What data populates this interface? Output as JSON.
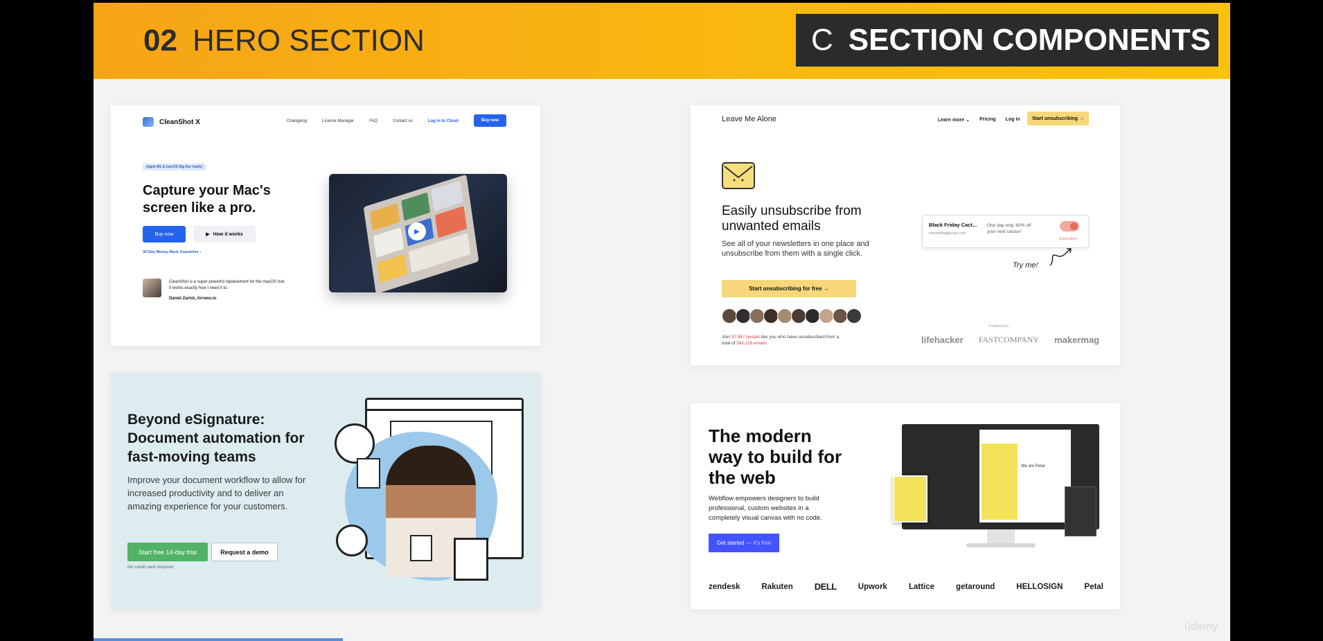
{
  "banner": {
    "number": "02",
    "title": "HERO SECTION",
    "right_letter": "C",
    "right_title": "SECTION COMPONENTS"
  },
  "cleanshot": {
    "logo": "CleanShot X",
    "nav": [
      "Changelog",
      "License Manager",
      "FAQ",
      "Contact us",
      "Log in to Cloud"
    ],
    "buy_top": "Buy now",
    "pill": "Apple M1 & macOS Big Sur ready!",
    "headline": "Capture your Mac's screen like a pro.",
    "buy": "Buy now",
    "how": "How it works",
    "guarantee": "30-Day Money-Back Guarantee ›",
    "quote": "CleanShot is a super powerful replacement for the macOS tool. It works exactly how I need it to.",
    "author": "Daniel Zarick, Arrows.to"
  },
  "leave_me_alone": {
    "logo": "Leave Me Alone",
    "nav": [
      "Learn more ⌄",
      "Pricing",
      "Log in"
    ],
    "cta_top": "Start unsubscribing →",
    "headline": "Easily unsubscribe from unwanted emails",
    "sub": "See all of your newsletters in one place and unsubscribe from them with a single click.",
    "cta": "Start unsubscribing for free →",
    "join_1": "Join ",
    "join_people": "37,967 people",
    "join_2": " like you who have unsubscribed from a total of ",
    "join_emails": "541,116 emails",
    "mail_title": "Black Friday Cact...",
    "mail_from": "rmarketing@cact.com",
    "mail_body": "One day only. 80% off your next cactus!",
    "mail_status": "Subscribed",
    "try": "Try me!",
    "featured": "Featured in",
    "press": [
      "lifehacker",
      "FASTCOMPANY",
      "makermag"
    ]
  },
  "esignature": {
    "headline": "Beyond eSignature: Document automation for fast-moving teams",
    "body": "Improve your document workflow to allow for increased productivity and to deliver an amazing experience for your customers.",
    "trial": "Start free 14-day trial",
    "demo": "Request a demo",
    "note": "No credit card required"
  },
  "webflow": {
    "headline": "The modern way to build for the web",
    "body": "Webflow empowers designers to build professional, custom websites in a completely visual canvas with no code.",
    "cta": "Get started",
    "cta_light": "— it's free",
    "canvas_text": "We are Petal",
    "logos": [
      "zendesk",
      "Rakuten",
      "DELL",
      "Upwork",
      "Lattice",
      "getaround",
      "HELLOSIGN",
      "Petal"
    ]
  },
  "watermark": "ūdemy",
  "colors": {
    "accent_orange": "#f7aa15",
    "dark": "#2b2b2b",
    "cleanshot_blue": "#2563eb",
    "webflow_blue": "#4353ff",
    "green": "#52b266"
  }
}
